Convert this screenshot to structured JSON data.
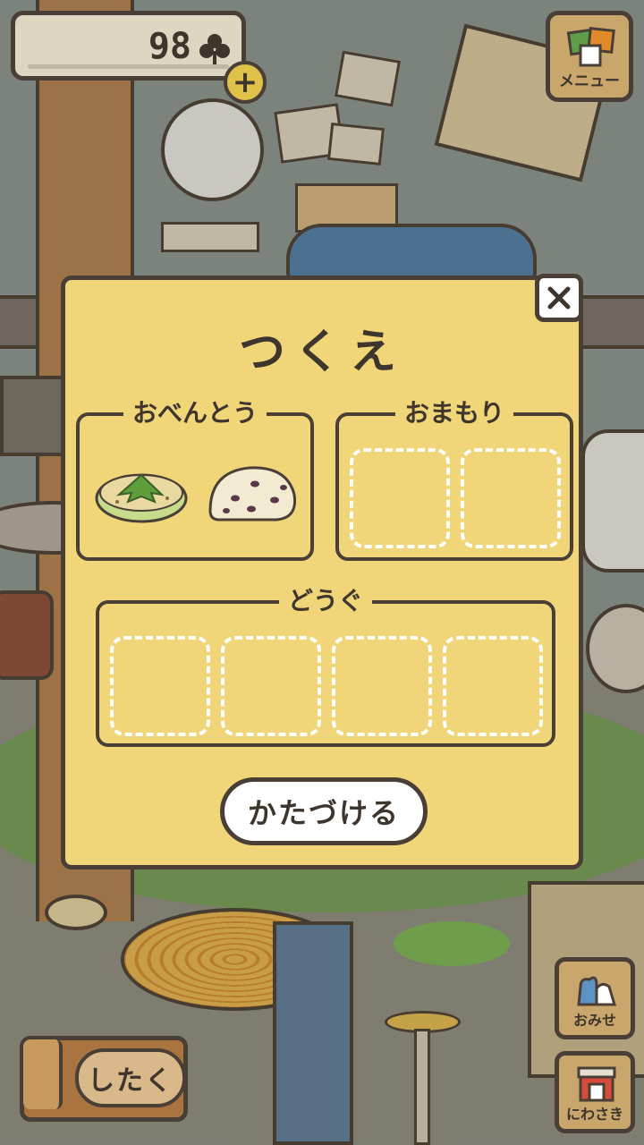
{
  "hud": {
    "clover_count": "98",
    "clover_icon": "clover-icon",
    "plus_icon": "plus-icon",
    "plus_label": "+"
  },
  "menu": {
    "label": "メニュー",
    "icon": "menu-icon"
  },
  "desk": {
    "title": "つくえ",
    "close_label": "×",
    "lunch": {
      "title": "おべんとう",
      "items": [
        {
          "name": "herb-flatbread-icon"
        },
        {
          "name": "bean-bread-icon"
        }
      ]
    },
    "charm": {
      "title": "おまもり",
      "slots": 2
    },
    "tool": {
      "title": "どうぐ",
      "slots": 4
    },
    "clear_label": "かたづける"
  },
  "buttons": {
    "shop_label": "おみせ",
    "garden_label": "にわさき",
    "prepare_label": "したく"
  },
  "colors": {
    "panel": "#f0d678",
    "outline": "#4a3f36",
    "wood": "#c9a66c",
    "slot_dash": "#ffffff"
  }
}
